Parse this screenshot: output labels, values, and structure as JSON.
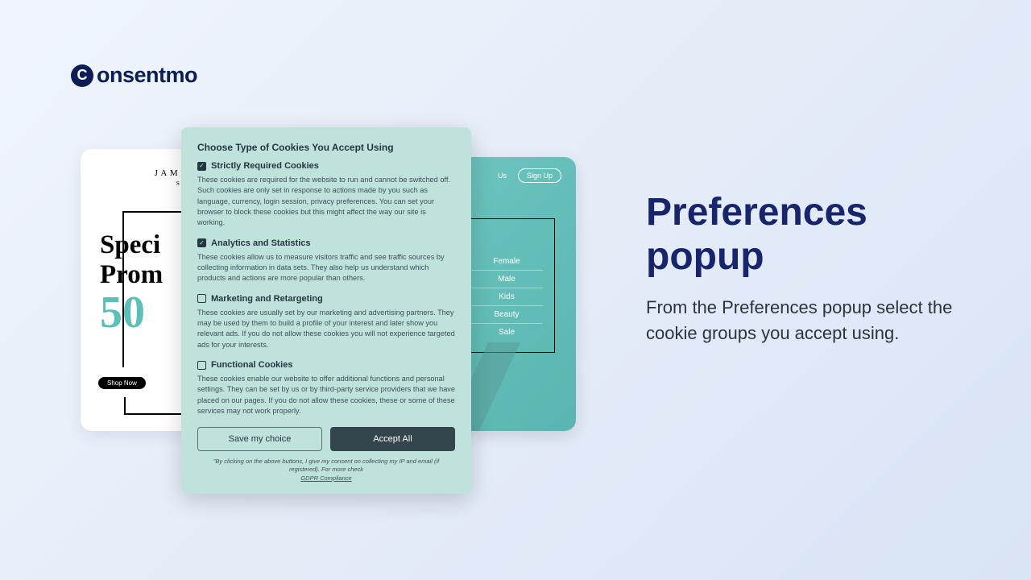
{
  "logo": {
    "text": "onsentmo"
  },
  "leftCard": {
    "studio_name": "JAMIE & AN",
    "studio_sub": "STUDIO",
    "promo_line1": "Speci",
    "promo_line2": "Prom",
    "percent": "50",
    "shop_now": "Shop Now"
  },
  "rightCard": {
    "nav_items": [
      "Us"
    ],
    "signup": "Sign Up",
    "menu": [
      "Female",
      "Male",
      "Kids",
      "Beauty",
      "Sale"
    ]
  },
  "popup": {
    "title": "Choose Type of Cookies You Accept Using",
    "groups": [
      {
        "checked": true,
        "title": "Strictly Required Cookies",
        "desc": "These cookies are required for the website to run and cannot be switched off. Such cookies are only set in response to actions made by you such as language, currency, login session, privacy preferences. You can set your browser to block these cookies but this might affect the way our site is working."
      },
      {
        "checked": true,
        "title": "Analytics and Statistics",
        "desc": "These cookies allow us to measure visitors traffic and see traffic sources by collecting information in data sets. They also help us understand which products and actions are more popular than others."
      },
      {
        "checked": false,
        "title": "Marketing and Retargeting",
        "desc": "These cookies are usually set by our marketing and advertising partners. They may be used by them to build a profile of your interest and later show you relevant ads. If you do not allow these cookies you will not experience targeted ads for your interests."
      },
      {
        "checked": false,
        "title": "Functional Cookies",
        "desc": "These cookies enable our website to offer additional functions and personal settings. They can be set by us or by third-party service providers that we have placed on our pages. If you do not allow these cookies, these or some of these services may not work properly."
      }
    ],
    "save_label": "Save my choice",
    "accept_label": "Accept All",
    "footer_prefix": "\"By clicking on the above buttons, I give my consent on collecting my IP and email (if registered). For more check ",
    "footer_link": "GDPR Compliance"
  },
  "rightPanel": {
    "title": "Preferences popup",
    "desc": "From the Preferences popup select the cookie groups you accept using."
  }
}
